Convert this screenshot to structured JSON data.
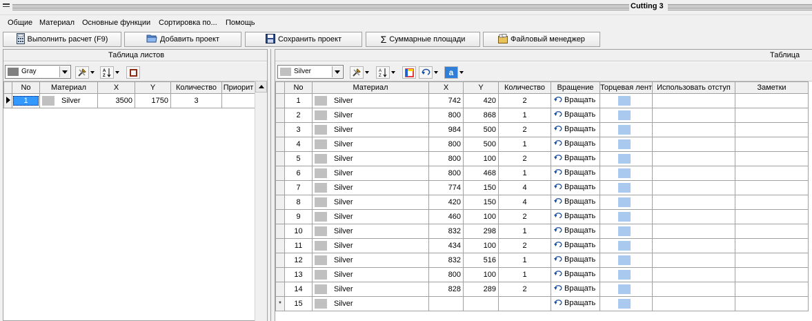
{
  "window": {
    "title": "Cutting 3"
  },
  "menu": [
    "Общие",
    "Материал",
    "Основные функции",
    "Сортировка по...",
    "Помощь"
  ],
  "toolbar": {
    "run_label": "Выполнить расчет (F9)",
    "add_label": "Добавить проект",
    "save_label": "Сохранить проект",
    "sum_label": "Суммарные площади",
    "files_label": "Файловый менеджер"
  },
  "sheets": {
    "caption": "Таблица листов",
    "material_select": {
      "value": "Gray",
      "color": "#808080"
    },
    "columns": [
      "No",
      "Материал",
      "X",
      "Y",
      "Количество",
      "Приорит"
    ],
    "rows": [
      {
        "no": "1",
        "material": "Silver",
        "x": "3500",
        "y": "1750",
        "qty": "3",
        "prio": ""
      }
    ]
  },
  "details": {
    "caption": "Таблица дет",
    "material_select": {
      "value": "Silver",
      "color": "#c0c0c0"
    },
    "columns": [
      "No",
      "Материал",
      "X",
      "Y",
      "Количество",
      "Вращение",
      "Торцевая лент",
      "Использовать отступ",
      "Заметки"
    ],
    "rotate_label": "Вращать",
    "rows": [
      {
        "no": "1",
        "material": "Silver",
        "x": "742",
        "y": "420",
        "qty": "2"
      },
      {
        "no": "2",
        "material": "Silver",
        "x": "800",
        "y": "868",
        "qty": "1"
      },
      {
        "no": "3",
        "material": "Silver",
        "x": "984",
        "y": "500",
        "qty": "2"
      },
      {
        "no": "4",
        "material": "Silver",
        "x": "800",
        "y": "500",
        "qty": "1"
      },
      {
        "no": "5",
        "material": "Silver",
        "x": "800",
        "y": "100",
        "qty": "2"
      },
      {
        "no": "6",
        "material": "Silver",
        "x": "800",
        "y": "468",
        "qty": "1"
      },
      {
        "no": "7",
        "material": "Silver",
        "x": "774",
        "y": "150",
        "qty": "4"
      },
      {
        "no": "8",
        "material": "Silver",
        "x": "420",
        "y": "150",
        "qty": "4"
      },
      {
        "no": "9",
        "material": "Silver",
        "x": "460",
        "y": "100",
        "qty": "2"
      },
      {
        "no": "10",
        "material": "Silver",
        "x": "832",
        "y": "298",
        "qty": "1"
      },
      {
        "no": "11",
        "material": "Silver",
        "x": "434",
        "y": "100",
        "qty": "2"
      },
      {
        "no": "12",
        "material": "Silver",
        "x": "832",
        "y": "516",
        "qty": "1"
      },
      {
        "no": "13",
        "material": "Silver",
        "x": "800",
        "y": "100",
        "qty": "1"
      },
      {
        "no": "14",
        "material": "Silver",
        "x": "828",
        "y": "289",
        "qty": "2"
      },
      {
        "no": "15",
        "material": "Silver",
        "x": "",
        "y": "",
        "qty": ""
      }
    ],
    "new_row_marker": "*"
  }
}
